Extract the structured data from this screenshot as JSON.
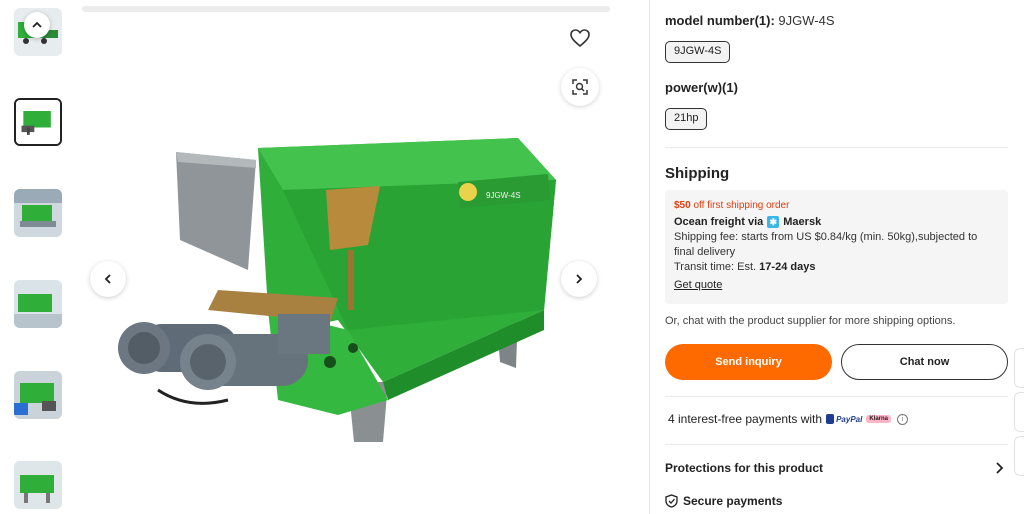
{
  "product": {
    "thumbnails": [
      {
        "name": "thumbnail-1"
      },
      {
        "name": "thumbnail-2",
        "active": true
      },
      {
        "name": "thumbnail-3"
      },
      {
        "name": "thumbnail-4"
      },
      {
        "name": "thumbnail-5"
      },
      {
        "name": "thumbnail-6"
      }
    ],
    "image_label": "9JGW-4S"
  },
  "attributes": {
    "model_title": "model number(1):",
    "model_value": "9JGW-4S",
    "model_chip": "9JGW-4S",
    "power_title": "power(w)(1)",
    "power_chip": "21hp"
  },
  "shipping": {
    "title": "Shipping",
    "promo_amount": "$50",
    "promo_text": "off first shipping order",
    "freight_prefix": "Ocean freight via",
    "carrier": "Maersk",
    "fee": "Shipping fee: starts from US $0.84/kg (min. 50kg),subjected to final delivery",
    "transit_prefix": "Transit time: Est.",
    "transit_days": "17-24 days",
    "quote_link": "Get quote",
    "chat_hint": "Or, chat with the product supplier for more shipping options."
  },
  "actions": {
    "inquiry_label": "Send inquiry",
    "chat_label": "Chat now"
  },
  "payments": {
    "text": "4 interest-free payments with",
    "paypal": "PayPal",
    "klarna": "Klarna"
  },
  "protections": {
    "title": "Protections for this product",
    "secure": "Secure payments"
  },
  "colors": {
    "accent": "#ff6a00",
    "promo": "#e23d0e",
    "machine_green": "#2fae3a"
  }
}
